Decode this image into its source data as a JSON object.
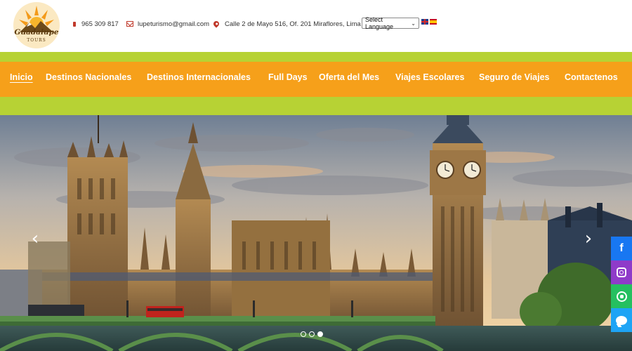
{
  "header": {
    "logo": {
      "brand": "Guadalupe",
      "sub": "TOURS"
    },
    "phone": "965 309 817",
    "email": "lupeturismo@gmail.com",
    "address": "Calle 2 de Mayo 516, Of. 201 Miraflores, Lima",
    "language_select": {
      "selected": "Select Language"
    },
    "flags": [
      "uk-flag",
      "spain-flag"
    ]
  },
  "nav": {
    "items": [
      {
        "label": "Inicio"
      },
      {
        "label": "Destinos Nacionales"
      },
      {
        "label": "Destinos Internacionales"
      },
      {
        "label": "Full Days"
      },
      {
        "label": "Oferta del Mes"
      },
      {
        "label": "Viajes Escolares"
      },
      {
        "label": "Seguro de Viajes"
      },
      {
        "label": "Contactenos"
      }
    ],
    "active_index": 0
  },
  "slider": {
    "image": "london-big-ben-parliament",
    "slide_count": 3,
    "active_slide": 3
  },
  "social": [
    "facebook-icon",
    "instagram-icon",
    "whatsapp-icon",
    "messenger-icon"
  ],
  "colors": {
    "nav_orange": "#f6a01a",
    "band_green": "#b7d234",
    "accent_red": "#c0392b",
    "facebook": "#1877f2",
    "instagram": "#8f3bc9",
    "whatsapp": "#25c060",
    "messenger": "#1ea4f5"
  }
}
